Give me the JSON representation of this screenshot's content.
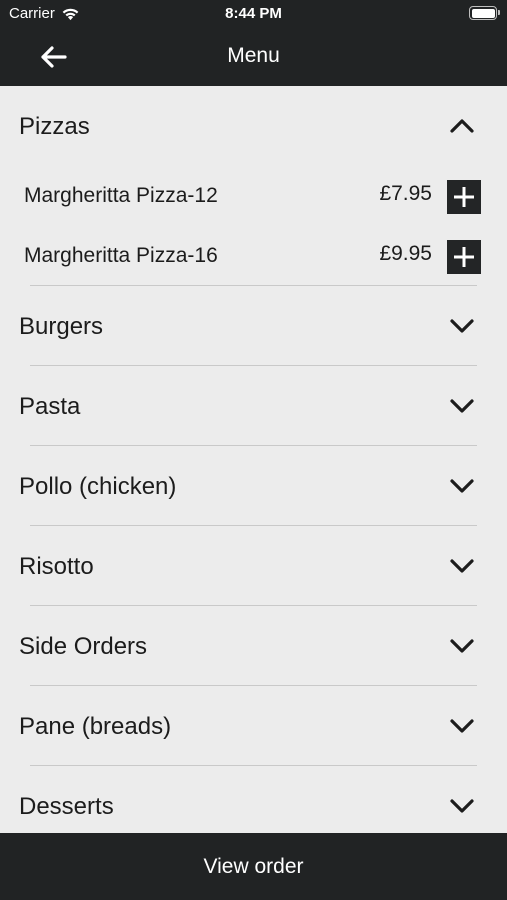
{
  "status_bar": {
    "carrier": "Carrier",
    "time": "8:44 PM",
    "battery_level": 1.0
  },
  "nav": {
    "title": "Menu",
    "back_icon": "arrow-left-icon"
  },
  "categories": [
    {
      "name": "Pizzas",
      "expanded": true,
      "items": [
        {
          "name": "Margheritta Pizza-12",
          "price": "£7.95"
        },
        {
          "name": "Margheritta Pizza-16",
          "price": "£9.95"
        }
      ]
    },
    {
      "name": "Burgers",
      "expanded": false
    },
    {
      "name": "Pasta",
      "expanded": false
    },
    {
      "name": "Pollo (chicken)",
      "expanded": false
    },
    {
      "name": "Risotto",
      "expanded": false
    },
    {
      "name": "Side Orders",
      "expanded": false
    },
    {
      "name": "Pane (breads)",
      "expanded": false
    },
    {
      "name": "Desserts",
      "expanded": false
    }
  ],
  "footer": {
    "view_order_label": "View order"
  },
  "colors": {
    "bar_bg": "#212324",
    "list_bg": "#ececec",
    "text": "#1c1c1c",
    "divider": "#c9c9c9"
  }
}
